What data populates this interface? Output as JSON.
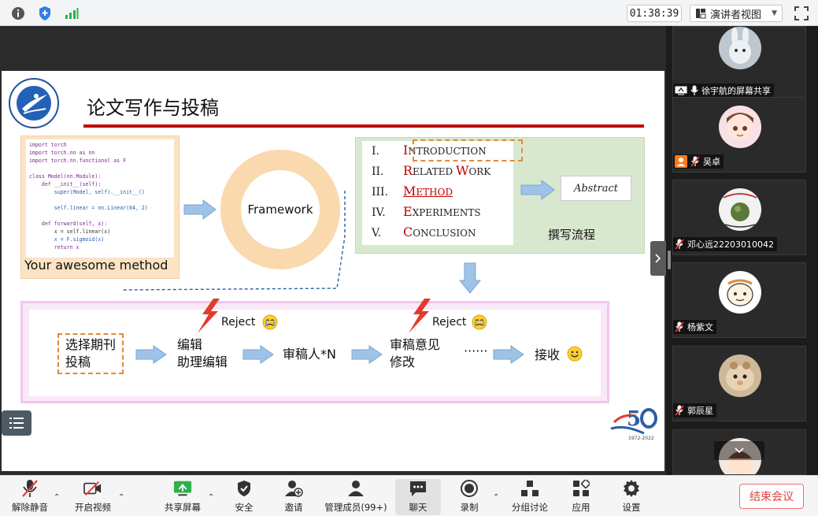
{
  "topbar": {
    "timer": "01:38:39",
    "view_mode": "演讲者视图",
    "icons": [
      "info-icon",
      "shield-icon",
      "signal-icon",
      "fullscreen-icon"
    ]
  },
  "slide": {
    "title": "论文写作与投稿",
    "code_lines": [
      "import torch",
      "import torch.nn as nn",
      "import torch.nn.functional as F",
      "",
      "class Model(nn.Module):",
      "    def __init__(self):",
      "        super(Model, self).__init__()",
      "",
      "        self.linear = nn.Linear(64, 2)",
      "",
      "    def forward(self, x):",
      "        x = self.linear(x)",
      "        x = F.sigmoid(x)",
      "        return x"
    ],
    "code_caption": "Your awesome method",
    "framework_label": "Framework",
    "outline": [
      {
        "roman": "I.",
        "first": "I",
        "rest": "NTRODUCTION"
      },
      {
        "roman": "II.",
        "first": "R",
        "rest": "ELATED ",
        "first2": "W",
        "rest2": "ORK"
      },
      {
        "roman": "III.",
        "first": "M",
        "rest": "ETHOD"
      },
      {
        "roman": "IV.",
        "first": "E",
        "rest": "XPERIMENTS"
      },
      {
        "roman": "V.",
        "first": "C",
        "rest": "ONCLUSION"
      }
    ],
    "abstract_label": "Abstract",
    "flow_label": "撰写流程",
    "process": {
      "step1_line1": "选择期刊",
      "step1_line2": "投稿",
      "step2_line1": "编辑",
      "step2_line2": "助理编辑",
      "step3": "审稿人*N",
      "step4_line1": "审稿意见",
      "step4_line2": "修改",
      "step5": "······",
      "step6": "接收",
      "reject1": "Reject",
      "reject2": "Reject"
    },
    "anniversary_years": "1972-2022"
  },
  "participants": [
    {
      "name": "徐宇航的屏幕共享",
      "kind": "screen-share"
    },
    {
      "name": "吴卓",
      "kind": "host"
    },
    {
      "name": "邓心远22203010042",
      "kind": "member"
    },
    {
      "name": "杨紫文",
      "kind": "member"
    },
    {
      "name": "郭辰星",
      "kind": "member"
    }
  ],
  "toolbar": {
    "unmute": "解除静音",
    "start_video": "开启视频",
    "share_screen": "共享屏幕",
    "security": "安全",
    "invite": "邀请",
    "members": "管理成员(99+)",
    "chat": "聊天",
    "record": "录制",
    "breakout": "分组讨论",
    "apps": "应用",
    "settings": "设置",
    "end_meeting": "结束会议"
  }
}
